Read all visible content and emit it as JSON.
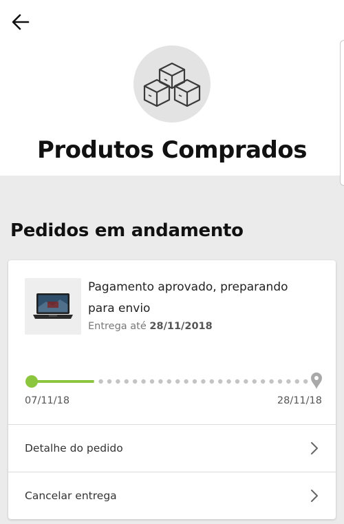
{
  "header": {
    "back_icon": "arrow-left-icon",
    "hero_icon": "boxes-icon",
    "title": "Produtos Comprados"
  },
  "section": {
    "title": "Pedidos em andamento"
  },
  "order": {
    "status": "Pagamento aprovado, preparando para envio",
    "delivery_prefix": "Entrega até",
    "delivery_date": "28/11/2018",
    "product_image": "laptop-thumbnail",
    "progress": {
      "start_date": "07/11/18",
      "end_date": "28/11/18",
      "fraction_complete": 0.22,
      "end_icon": "map-pin-icon"
    },
    "actions": [
      {
        "label": "Detalhe do pedido",
        "icon": "chevron-right-icon"
      },
      {
        "label": "Cancelar entrega",
        "icon": "chevron-right-icon"
      }
    ]
  },
  "colors": {
    "accent": "#8cc63f",
    "dots": "#c4c4c4",
    "background": "#ebebeb"
  }
}
